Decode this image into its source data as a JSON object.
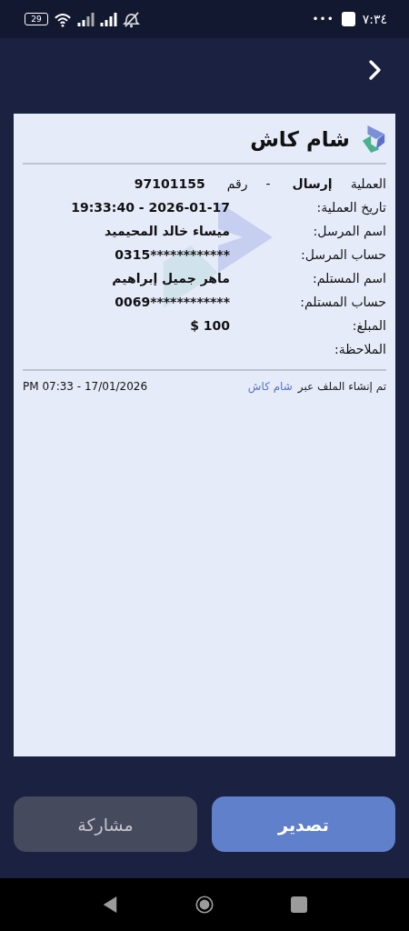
{
  "status_bar": {
    "battery": "29",
    "more": "•••",
    "time": "٧:٣٤"
  },
  "receipt": {
    "brand": "شام كاش",
    "operation": {
      "label": "العملية",
      "type": "إرسال",
      "separator": "-",
      "number_label": "رقم",
      "number": "97101155"
    },
    "rows": [
      {
        "label": "تاريخ العملية:",
        "value": "19:33:40 - 2026-01-17",
        "kind": "ltr"
      },
      {
        "label": "اسم المرسل:",
        "value": "ميساء خالد المحيميد",
        "kind": "name"
      },
      {
        "label": "حساب المرسل:",
        "value": "0315************",
        "kind": "ltr"
      },
      {
        "label": "اسم المستلم:",
        "value": "ماهر جميل إبراهيم",
        "kind": "name"
      },
      {
        "label": "حساب المستلم:",
        "value": "0069************",
        "kind": "ltr"
      },
      {
        "label": "المبلغ:",
        "value": "$ 100",
        "kind": "ltr"
      },
      {
        "label": "الملاحظة:",
        "kind": "empty"
      }
    ],
    "footer": {
      "created_via": "تم إنشاء الملف عبر",
      "link": "شام كاش",
      "timestamp": "PM 07:33 - 17/01/2026"
    }
  },
  "buttons": [
    {
      "label": "تصدير",
      "kind": "primary"
    },
    {
      "label": "مشاركة",
      "kind": "secondary"
    }
  ]
}
